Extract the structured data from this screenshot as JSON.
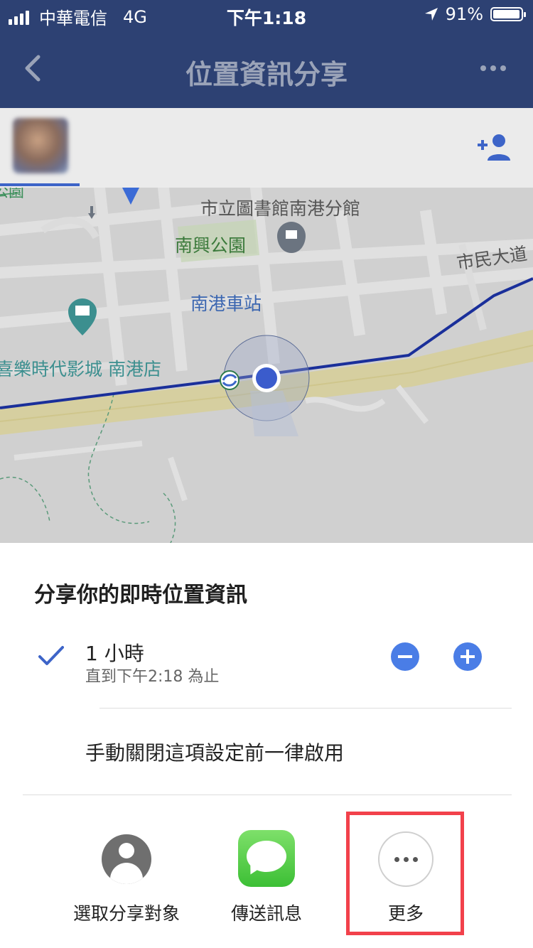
{
  "status_bar": {
    "carrier": "中華電信",
    "network": "4G",
    "time": "下午1:18",
    "battery": "91%",
    "icons": [
      "signal-icon",
      "location-arrow-icon",
      "battery-icon"
    ]
  },
  "nav": {
    "title": "位置資訊分享",
    "back_icon": "chevron-left-icon",
    "more_icon": "more-horizontal-icon"
  },
  "tabs": {
    "add_person_icon": "add-person-icon"
  },
  "map": {
    "labels": {
      "library": "市立圖書館南港分館",
      "park": "南興公園",
      "road": "市民大道",
      "station": "南港車站",
      "cinema": "喜樂時代影城 南港店",
      "park_partial": "公園"
    },
    "colors": {
      "route": "#1a2f9a",
      "location_dot": "#3b5ccc",
      "poi_teal": "#3c8f8f",
      "poi_gray": "#6b7480",
      "poi_blue": "#3b6bd6"
    }
  },
  "sheet": {
    "title": "分享你的即時位置資訊",
    "duration": {
      "label": "1 小時",
      "sub": "直到下午2:18 為止",
      "selected": true
    },
    "manual_option": "手動關閉這項設定前一律啟用",
    "share_targets": [
      {
        "label": "選取分享對象",
        "icon": "contact-icon"
      },
      {
        "label": "傳送訊息",
        "icon": "messages-icon"
      },
      {
        "label": "更多",
        "icon": "more-icon"
      }
    ],
    "accent_color": "#4a7de6",
    "highlight_color": "#f2414b"
  }
}
